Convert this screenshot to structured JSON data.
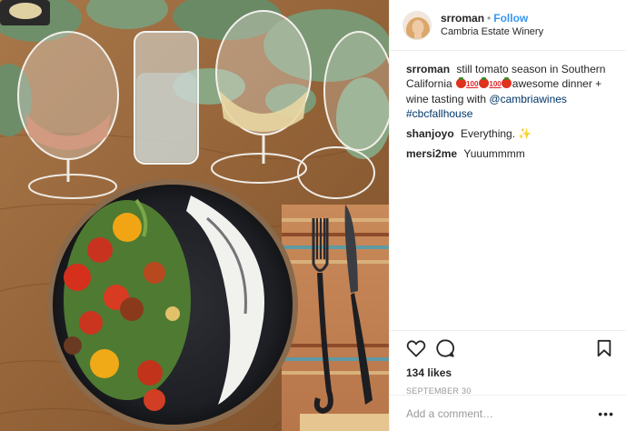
{
  "photo": {
    "alt_icon": "food-photo"
  },
  "header": {
    "username": "srroman",
    "separator": "•",
    "follow_label": "Follow",
    "location": "Cambria Estate Winery"
  },
  "caption": {
    "username": "srroman",
    "text_before_emoji": "still tomato season in Southern California",
    "emoji": [
      "tomato",
      "hundred",
      "tomato",
      "hundred",
      "tomato"
    ],
    "text_after_emoji": "awesome dinner + wine tasting with",
    "mention": "@cambriawines",
    "hashtag": "#cbcfallhouse"
  },
  "comments": [
    {
      "username": "shanjoyo",
      "text": "Everything.",
      "emoji": "sparkles"
    },
    {
      "username": "mersi2me",
      "text": "Yuuummmm"
    }
  ],
  "actions": {
    "like_icon": "heart-icon",
    "comment_icon": "comment-icon",
    "save_icon": "bookmark-icon"
  },
  "likes": "134 likes",
  "date": "SEPTEMBER 30",
  "add_comment": {
    "placeholder": "Add a comment…",
    "more": "•••"
  },
  "colors": {
    "follow": "#3897f0",
    "link": "#003569",
    "muted": "#999999",
    "border": "#efefef"
  }
}
